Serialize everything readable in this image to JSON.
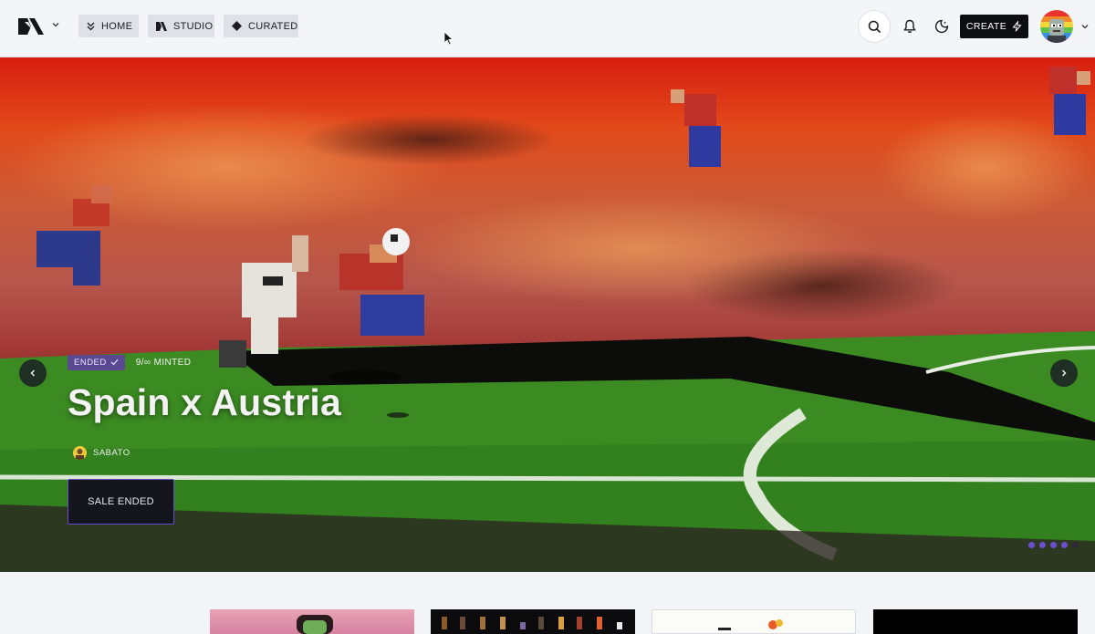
{
  "nav": {
    "home_label": "HOME",
    "studio_label": "STUDIO",
    "curated_label": "CURATED",
    "create_label": "CREATE"
  },
  "hero": {
    "status_badge": "ENDED",
    "minted": "9/∞ MINTED",
    "title": "Spain x Austria",
    "artist": "SABATO",
    "sale_button": "SALE ENDED",
    "slide_count": 5,
    "active_slide": 5
  },
  "colors": {
    "accent_purple": "#6c4ccf",
    "badge_purple": "#5a4891",
    "create_bg": "#0d0e12",
    "pitch_green": "#3d8a22"
  },
  "icons": [
    "logo-icon",
    "chevron-down-icon",
    "double-chevron-icon",
    "studio-icon",
    "diamond-icon",
    "search-icon",
    "bell-icon",
    "moon-icon",
    "bolt-icon",
    "check-icon",
    "chevron-left-icon",
    "chevron-right-icon"
  ]
}
